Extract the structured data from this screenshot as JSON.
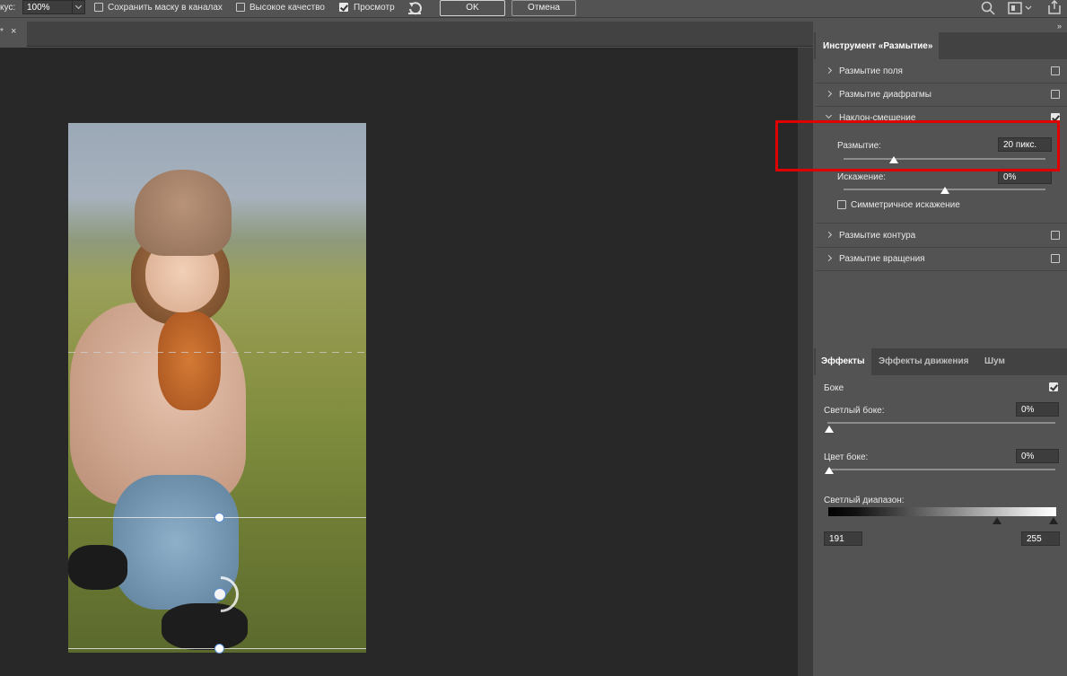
{
  "optbar": {
    "focus_label": "кус:",
    "focus_value": "100%",
    "save_mask_label": "Сохранить маску в каналах",
    "save_mask_checked": false,
    "high_quality_label": "Высокое качество",
    "high_quality_checked": false,
    "preview_label": "Просмотр",
    "preview_checked": true,
    "reset_icon": "undo-icon",
    "ok_label": "OK",
    "cancel_label": "Отмена",
    "search_icon": "search-icon",
    "workspace_icon": "window-icon",
    "share_icon": "share-icon"
  },
  "doctab": {
    "modified_mark": "*",
    "close_icon": "×"
  },
  "panel": {
    "collapse_icon": "»",
    "tab_title": "Инструмент «Размытие»",
    "items": [
      {
        "label": "Размытие поля",
        "checked": false,
        "expanded": false
      },
      {
        "label": "Размытие диафрагмы",
        "checked": false,
        "expanded": false
      },
      {
        "label": "Наклон-смещение",
        "checked": true,
        "expanded": true
      },
      {
        "label": "Размытие контура",
        "checked": false,
        "expanded": false
      },
      {
        "label": "Размытие вращения",
        "checked": false,
        "expanded": false
      }
    ],
    "tilt": {
      "blur_label": "Размытие:",
      "blur_value": "20 пикс.",
      "blur_level": 0.25,
      "distortion_label": "Искажение:",
      "distortion_value": "0%",
      "distortion_level": 0.5,
      "symmetric_label": "Симметричное искажение",
      "symmetric_checked": false
    }
  },
  "effects": {
    "tabs": [
      "Эффекты",
      "Эффекты движения",
      "Шум"
    ],
    "active_tab": 0,
    "bokeh_label": "Боке",
    "bokeh_checked": true,
    "light_bokeh_label": "Светлый боке:",
    "light_bokeh_value": "0%",
    "bokeh_color_label": "Цвет боке:",
    "bokeh_color_value": "0%",
    "light_range_label": "Светлый диапазон:",
    "light_range_min": "191",
    "light_range_max": "255"
  },
  "colors": {
    "highlight": "#e00000",
    "pin_border": "#5e8fd3"
  }
}
